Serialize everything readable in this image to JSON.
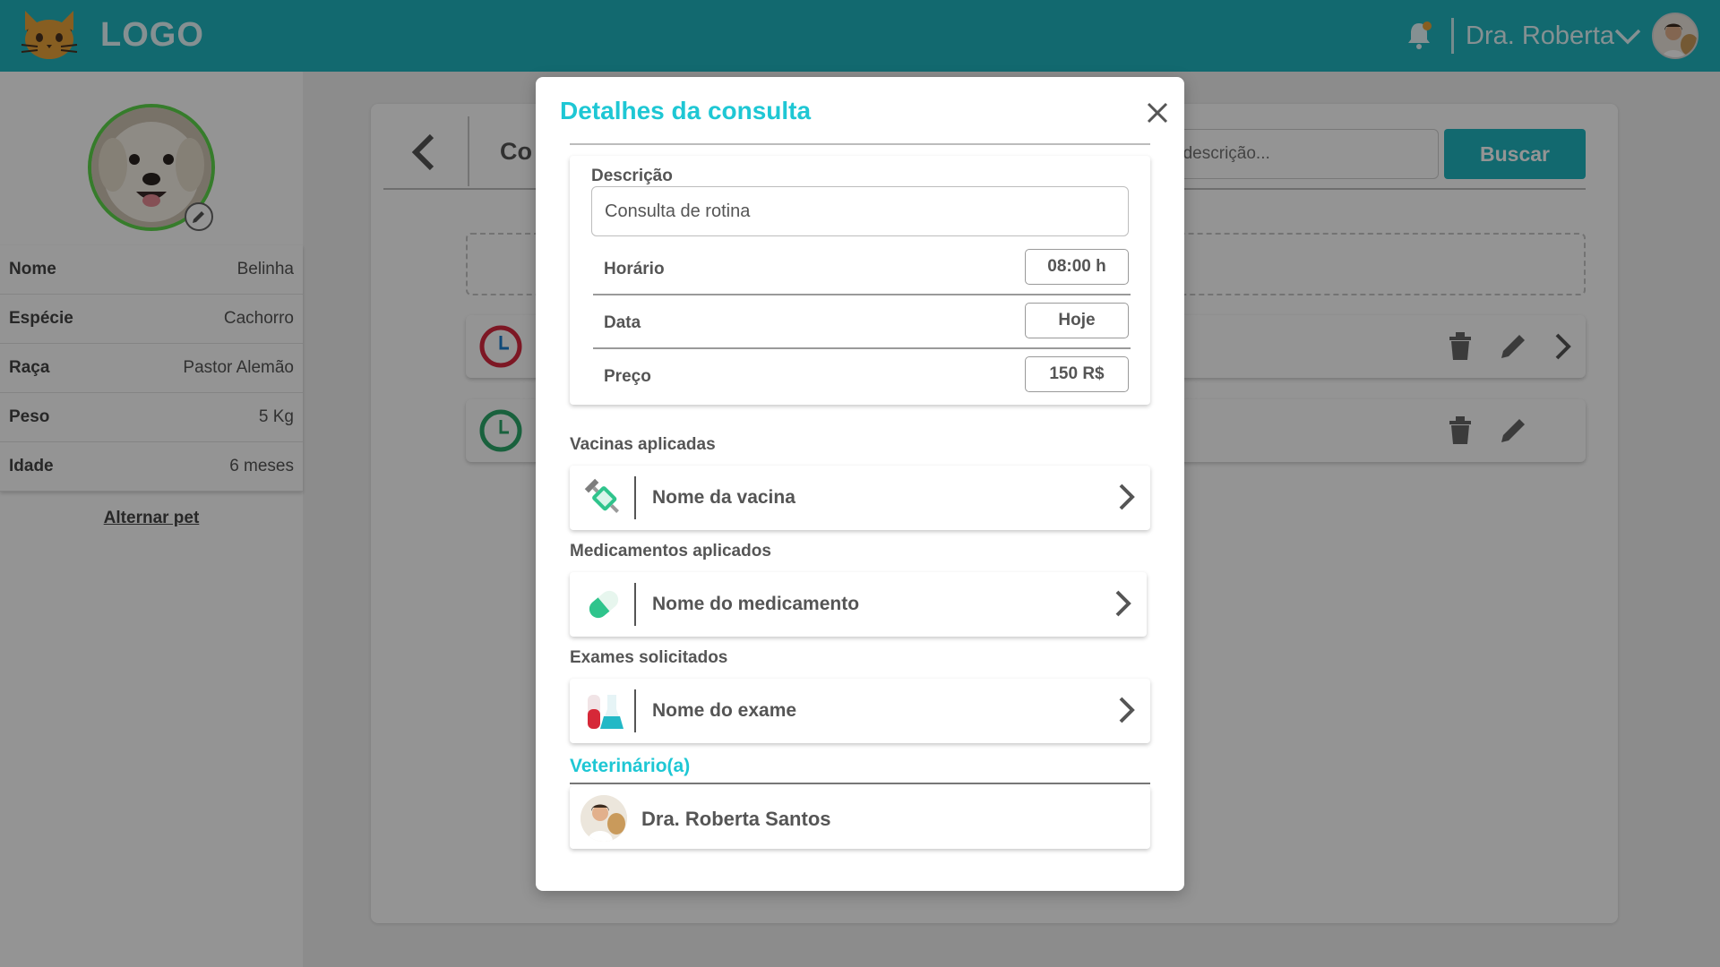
{
  "header": {
    "logo_text": "LOGO",
    "user_name": "Dra. Roberta",
    "brand_color": "#1fb6bf"
  },
  "sidebar": {
    "pet_info": [
      {
        "label": "Nome",
        "value": "Belinha"
      },
      {
        "label": "Espécie",
        "value": "Cachorro"
      },
      {
        "label": "Raça",
        "value": "Pastor Alemão"
      },
      {
        "label": "Peso",
        "value": "5 Kg"
      },
      {
        "label": "Idade",
        "value": "6 meses"
      }
    ],
    "switch_pet_label": "Alternar pet"
  },
  "main": {
    "title_partial": "Co",
    "search_placeholder": "r descrição...",
    "search_button": "Buscar"
  },
  "modal": {
    "title": "Detalhes da consulta",
    "description_label": "Descrição",
    "description_value": "Consulta de rotina",
    "fields": [
      {
        "label": "Horário",
        "value": "08:00 h"
      },
      {
        "label": "Data",
        "value": "Hoje"
      },
      {
        "label": "Preço",
        "value": "150 R$"
      }
    ],
    "vaccines_label": "Vacinas aplicadas",
    "vaccine_item": "Nome da vacina",
    "medications_label": "Medicamentos aplicados",
    "medication_item": "Nome do medicamento",
    "exams_label": "Exames solicitados",
    "exam_item": "Nome do exame",
    "vet_label": "Veterinário(a)",
    "vet_name": "Dra. Roberta Santos",
    "accent_color": "#1ec7d4"
  }
}
